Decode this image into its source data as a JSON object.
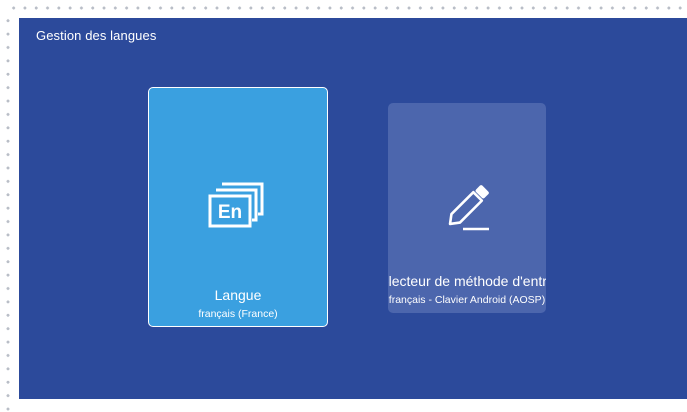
{
  "header": {
    "title": "Gestion des langues"
  },
  "cards": [
    {
      "label": "Langue",
      "value": "français (France)",
      "icon": "language-en-icon"
    },
    {
      "label": "Sélecteur de méthode d'entrée",
      "value": "français - Clavier Android (AOSP)",
      "icon": "pencil-icon"
    }
  ],
  "colors": {
    "background": "#2c4a9b",
    "selected_card": "#3aa0e0",
    "card": "#4c66ad",
    "text": "#ffffff"
  }
}
